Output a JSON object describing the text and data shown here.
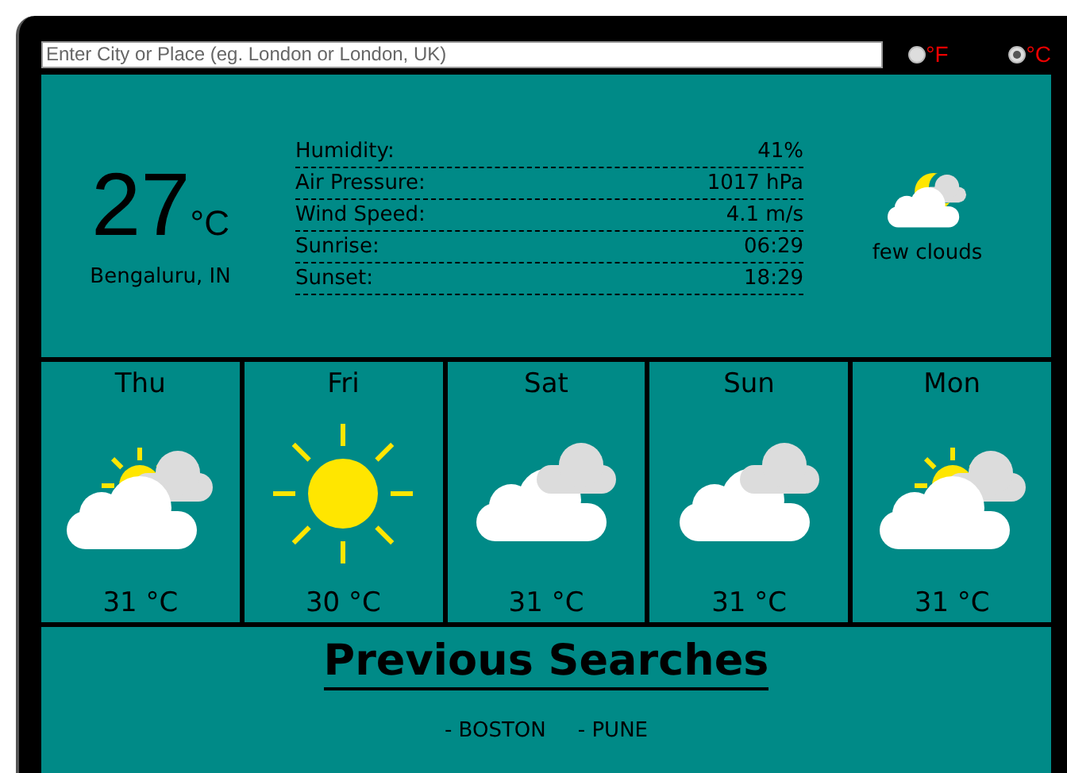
{
  "search": {
    "placeholder": "Enter City or Place (eg. London or London, UK)"
  },
  "units": [
    {
      "label": "°F",
      "selected": false
    },
    {
      "label": "°C",
      "selected": true
    }
  ],
  "current": {
    "temperature": "27",
    "unit": "°C",
    "location": "Bengaluru, IN",
    "kind": "night",
    "description": "few clouds",
    "details": [
      {
        "label": "Humidity:",
        "value": "41%"
      },
      {
        "label": "Air Pressure:",
        "value": "1017 hPa"
      },
      {
        "label": "Wind Speed:",
        "value": "4.1 m/s"
      },
      {
        "label": "Sunrise:",
        "value": "06:29"
      },
      {
        "label": "Sunset:",
        "value": "18:29"
      }
    ]
  },
  "forecast": [
    {
      "day": "Thu",
      "kind": "partly",
      "temperature": "31 °C"
    },
    {
      "day": "Fri",
      "kind": "sunny",
      "temperature": "30 °C"
    },
    {
      "day": "Sat",
      "kind": "cloudy",
      "temperature": "31 °C"
    },
    {
      "day": "Sun",
      "kind": "cloudy",
      "temperature": "31 °C"
    },
    {
      "day": "Mon",
      "kind": "partly",
      "temperature": "31 °C"
    }
  ],
  "previous_searches": {
    "title": "Previous Searches",
    "items": [
      "- BOSTON",
      "- PUNE"
    ]
  }
}
